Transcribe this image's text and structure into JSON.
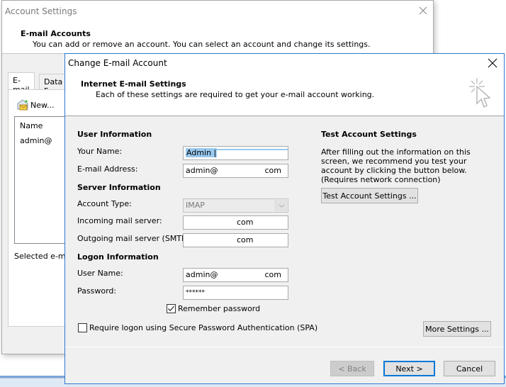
{
  "background_window": {
    "title": "Account Settings",
    "header_title": "E-mail Accounts",
    "header_description": "You can add or remove an account. You can select an account and change its settings.",
    "tabs": [
      {
        "label": "E-mail",
        "active": true
      },
      {
        "label": "Data F",
        "active": false
      }
    ],
    "toolbar": {
      "new_label": "New..."
    },
    "list": {
      "column_header": "Name",
      "rows": [
        {
          "name": "admin@"
        }
      ]
    },
    "selected_label": "Selected e-mail"
  },
  "dialog": {
    "title": "Change E-mail Account",
    "header_title": "Internet E-mail Settings",
    "header_description": "Each of these settings are required to get your e-mail account working.",
    "user_information": {
      "heading": "User Information",
      "your_name_label": "Your Name:",
      "your_name_value": "Admin |",
      "email_label": "E-mail Address:",
      "email_value_prefix": "admin@",
      "email_value_suffix": "com"
    },
    "server_information": {
      "heading": "Server Information",
      "account_type_label": "Account Type:",
      "account_type_value": "IMAP",
      "incoming_label": "Incoming mail server:",
      "incoming_value_suffix": "com",
      "outgoing_label": "Outgoing mail server (SMTP):",
      "outgoing_value_suffix": "com"
    },
    "logon_information": {
      "heading": "Logon Information",
      "username_label": "User Name:",
      "username_value_prefix": "admin@",
      "username_value_suffix": "com",
      "password_label": "Password:",
      "password_value": "******",
      "remember_password_label": "Remember password",
      "remember_password_checked": true,
      "spa_label": "Require logon using Secure Password Authentication (SPA)",
      "spa_checked": false
    },
    "test_settings": {
      "heading": "Test Account Settings",
      "description": "After filling out the information on this screen, we recommend you test your account by clicking the button below. (Requires network connection)",
      "test_button": "Test Account Settings ..."
    },
    "more_settings_button": "More Settings ...",
    "footer": {
      "back_button": "< Back",
      "next_button": "Next >",
      "cancel_button": "Cancel"
    }
  },
  "colors": {
    "accent": "#0078d7",
    "dialog_border": "#2b79d0",
    "selection": "#99c9ef"
  }
}
